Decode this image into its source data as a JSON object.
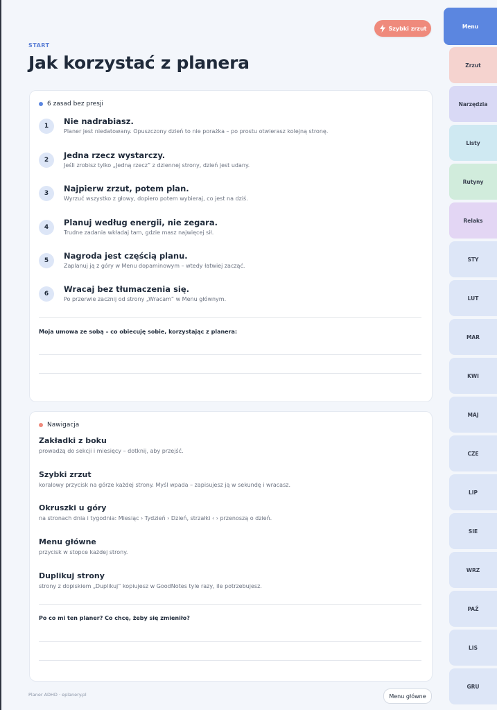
{
  "header": {
    "quick_button_label": "Szybki zrzut",
    "breadcrumb": "START",
    "title": "Jak korzystać z planera"
  },
  "rules_card": {
    "heading": "6 zasad bez presji",
    "dot_color": "#5b86e0",
    "rules": [
      {
        "num": "1",
        "title": "Nie nadrabiasz.",
        "desc": "Planer jest niedatowany. Opuszczony dzień to nie porażka – po prostu otwierasz kolejną stronę."
      },
      {
        "num": "2",
        "title": "Jedna rzecz wystarczy.",
        "desc": "Jeśli zrobisz tylko „Jedną rzecz” z dziennej strony, dzień jest udany."
      },
      {
        "num": "3",
        "title": "Najpierw zrzut, potem plan.",
        "desc": "Wyrzuć wszystko z głowy, dopiero potem wybieraj, co jest na dziś."
      },
      {
        "num": "4",
        "title": "Planuj według energii, nie zegara.",
        "desc": "Trudne zadania wkładaj tam, gdzie masz najwięcej sił."
      },
      {
        "num": "5",
        "title": "Nagroda jest częścią planu.",
        "desc": "Zaplanuj ją z góry w Menu dopaminowym – wtedy łatwiej zacząć."
      },
      {
        "num": "6",
        "title": "Wracaj bez tłumaczenia się.",
        "desc": "Po przerwie zacznij od strony „Wracam” w Menu głównym."
      }
    ],
    "prompt": "Moja umowa ze sobą – co obiecuję sobie, korzystając z planera:"
  },
  "nav_card": {
    "heading": "Nawigacja",
    "dot_color": "#ef8a7c",
    "items": [
      {
        "title": "Zakładki z boku",
        "desc": "prowadzą do sekcji i miesięcy – dotknij, aby przejść."
      },
      {
        "title": "Szybki zrzut",
        "desc": "koralowy przycisk na górze każdej strony. Myśl wpada – zapisujesz ją w sekundę i wracasz."
      },
      {
        "title": "Okruszki u góry",
        "desc": "na stronach dnia i tygodnia: Miesiąc › Tydzień › Dzień, strzałki ‹ › przenoszą o dzień."
      },
      {
        "title": "Menu główne",
        "desc": "przycisk w stopce każdej strony."
      },
      {
        "title": "Duplikuj strony",
        "desc": "strony z dopiskiem „Duplikuj” kopiujesz w GoodNotes tyle razy, ile potrzebujesz."
      }
    ],
    "prompt": "Po co mi ten planer? Co chcę, żeby się zmieniło?"
  },
  "footer": {
    "brand": "Planer ADHD · eplanery.pl",
    "menu_button": "Menu główne"
  },
  "side_tabs": [
    {
      "label": "Menu",
      "color": "#5b86e0"
    },
    {
      "label": "Zrzut",
      "color": "#f5d3cf"
    },
    {
      "label": "Narzędzia",
      "color": "#d9d9f5"
    },
    {
      "label": "Listy",
      "color": "#cfe9f2"
    },
    {
      "label": "Rutyny",
      "color": "#d1ecdc"
    },
    {
      "label": "Relaks",
      "color": "#e3d6f4"
    },
    {
      "label": "STY",
      "color": "#dde6f7"
    },
    {
      "label": "LUT",
      "color": "#dde6f7"
    },
    {
      "label": "MAR",
      "color": "#dde6f7"
    },
    {
      "label": "KWI",
      "color": "#dde6f7"
    },
    {
      "label": "MAJ",
      "color": "#dde6f7"
    },
    {
      "label": "CZE",
      "color": "#dde6f7"
    },
    {
      "label": "LIP",
      "color": "#dde6f7"
    },
    {
      "label": "SIE",
      "color": "#dde6f7"
    },
    {
      "label": "WRZ",
      "color": "#dde6f7"
    },
    {
      "label": "PAŹ",
      "color": "#dde6f7"
    },
    {
      "label": "LIS",
      "color": "#dde6f7"
    },
    {
      "label": "GRU",
      "color": "#dde6f7"
    }
  ]
}
